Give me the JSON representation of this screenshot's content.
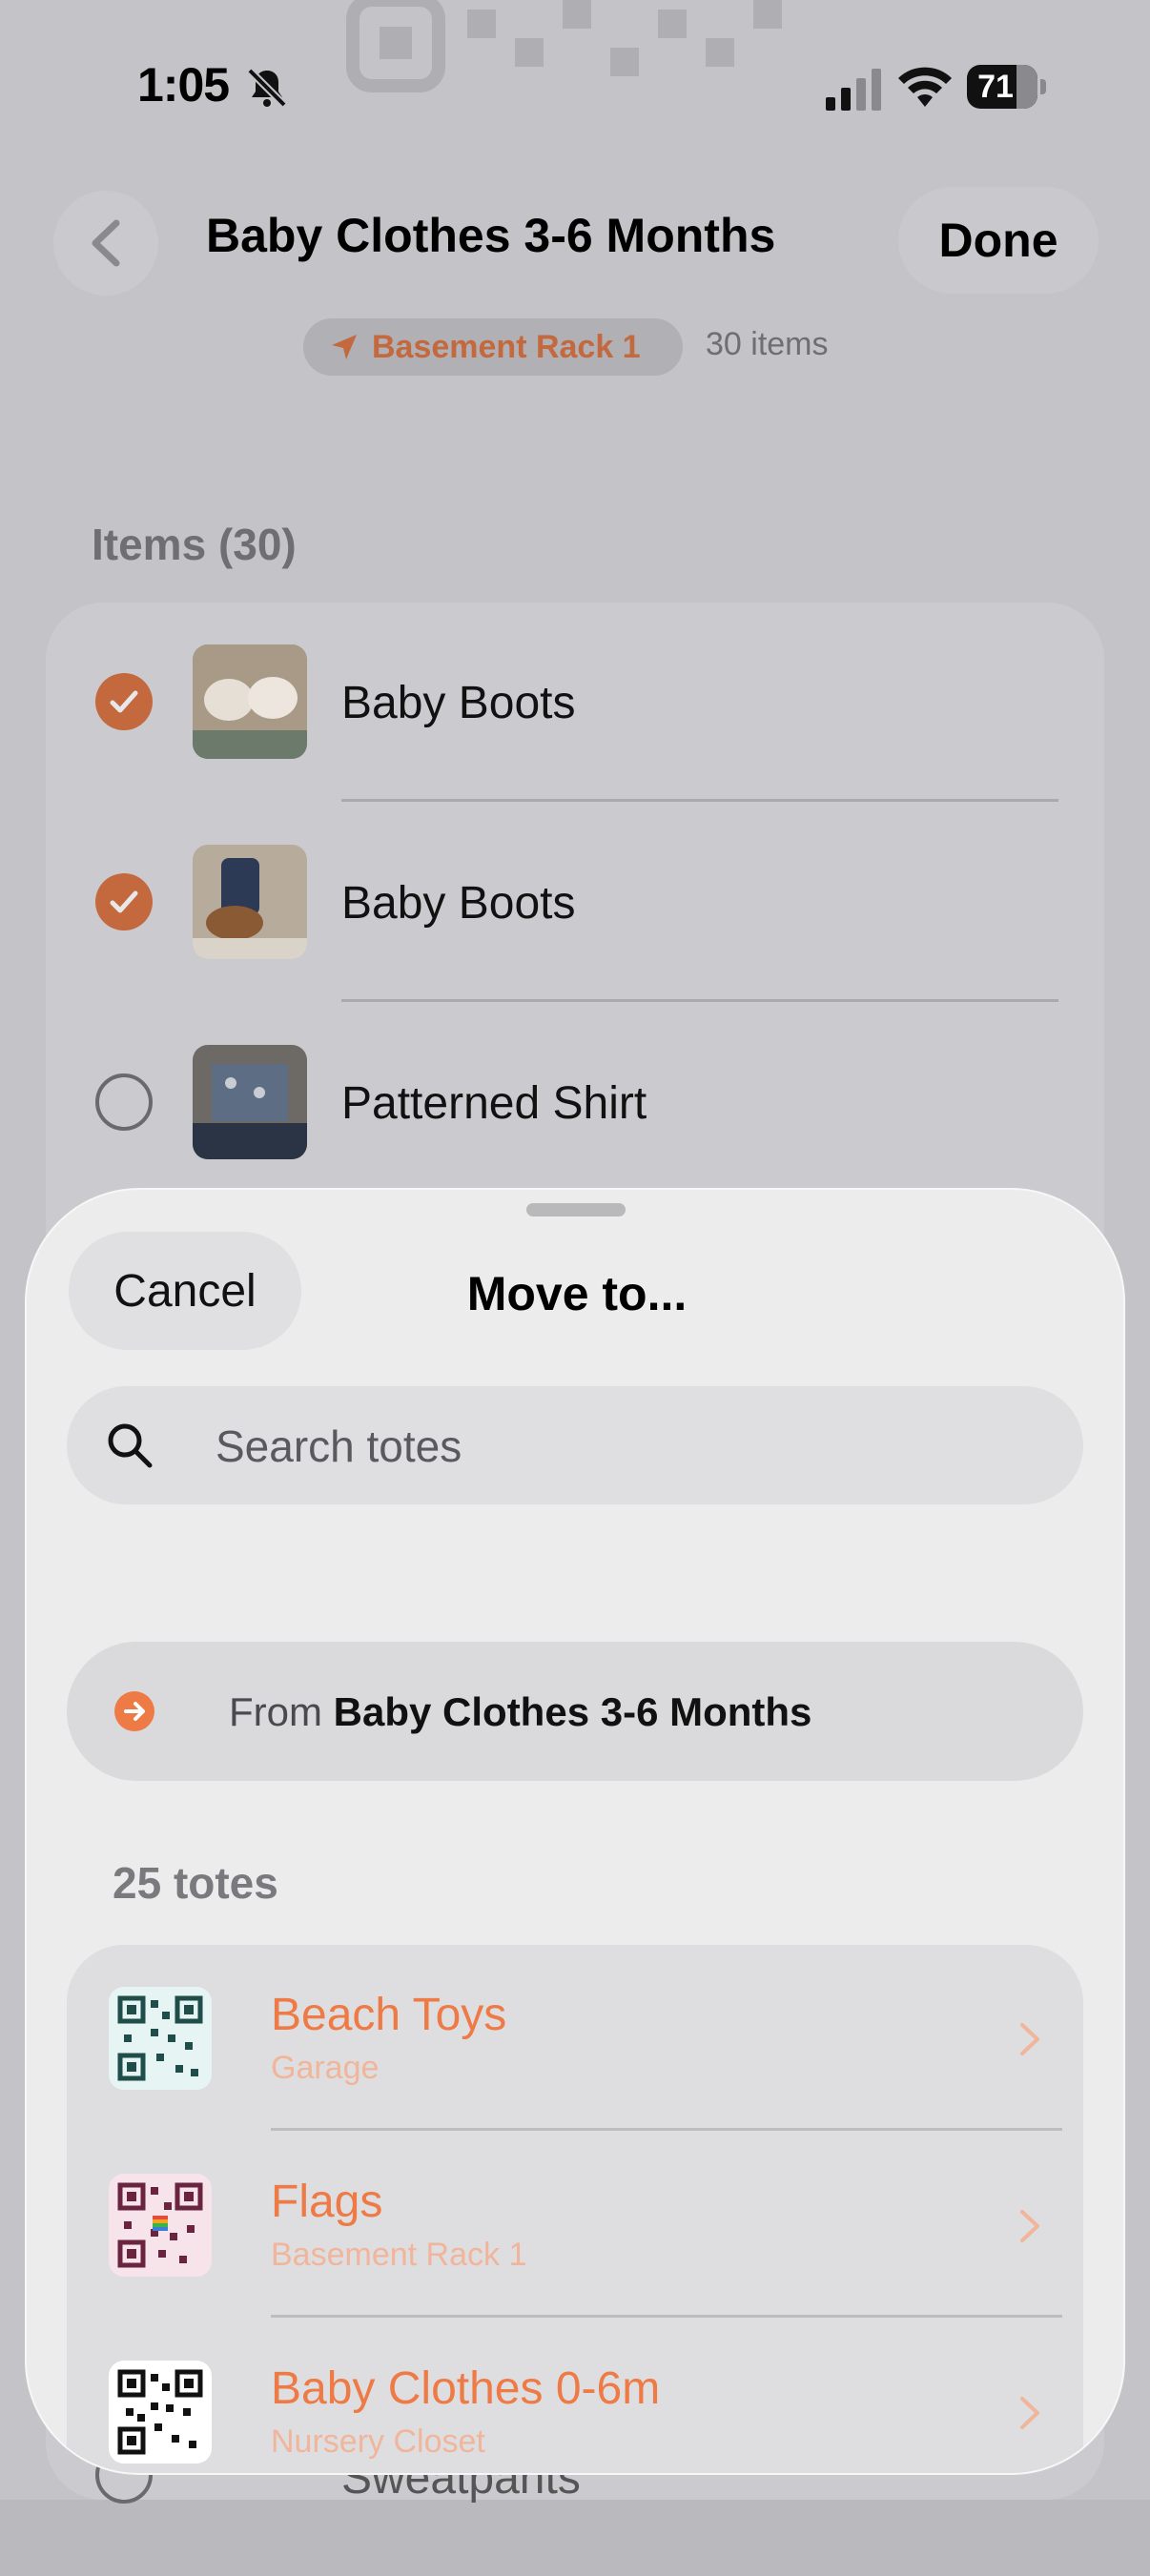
{
  "status_bar": {
    "time": "1:05",
    "battery": "71"
  },
  "nav": {
    "title": "Baby Clothes 3-6 Months",
    "done_label": "Done",
    "location": "Basement Rack 1",
    "item_count": "30 items"
  },
  "items_section": {
    "title": "Items (30)",
    "rows": [
      {
        "label": "Baby Boots",
        "checked": true
      },
      {
        "label": "Baby Boots",
        "checked": true
      },
      {
        "label": "Patterned Shirt",
        "checked": false
      },
      {
        "label": "Sweatpants",
        "checked": false
      }
    ]
  },
  "sheet": {
    "cancel_label": "Cancel",
    "title": "Move to...",
    "search_placeholder": "Search totes",
    "from_prefix": "From",
    "from_name": "Baby Clothes 3-6 Months",
    "totes_count": "25 totes",
    "totes": [
      {
        "name": "Beach Toys",
        "location": "Garage"
      },
      {
        "name": "Flags",
        "location": "Basement Rack 1"
      },
      {
        "name": "Baby Clothes 0-6m",
        "location": "Nursery Closet"
      }
    ]
  },
  "colors": {
    "accent": "#ee7a45",
    "accent_dim": "#c4683d",
    "sheet_bg": "#ececed"
  },
  "icons": [
    "back-chevron-icon",
    "bell-slash-icon",
    "signal-icon",
    "wifi-icon",
    "battery-icon",
    "location-arrow-icon",
    "checkmark-icon",
    "search-icon",
    "arrow-right-circle-icon",
    "chevron-right-icon",
    "qr-code-icon"
  ]
}
